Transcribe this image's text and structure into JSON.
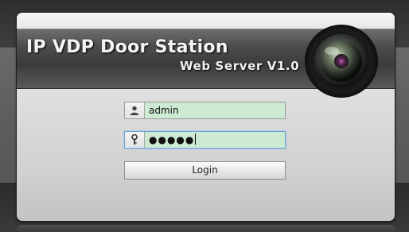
{
  "header": {
    "title": "IP VDP Door Station",
    "subtitle": "Web Server V1.0",
    "lens_icon": "camera-lens-icon"
  },
  "login_form": {
    "username": {
      "icon": "user-icon",
      "value": "admin"
    },
    "password": {
      "icon": "key-icon",
      "value": "●●●●●"
    },
    "login_label": "Login"
  },
  "colors": {
    "input_fill": "#cdebd2",
    "focus_border": "#6aa0d8",
    "header_dark": "#3b3b3b",
    "page_background": "#3a3a3a"
  }
}
